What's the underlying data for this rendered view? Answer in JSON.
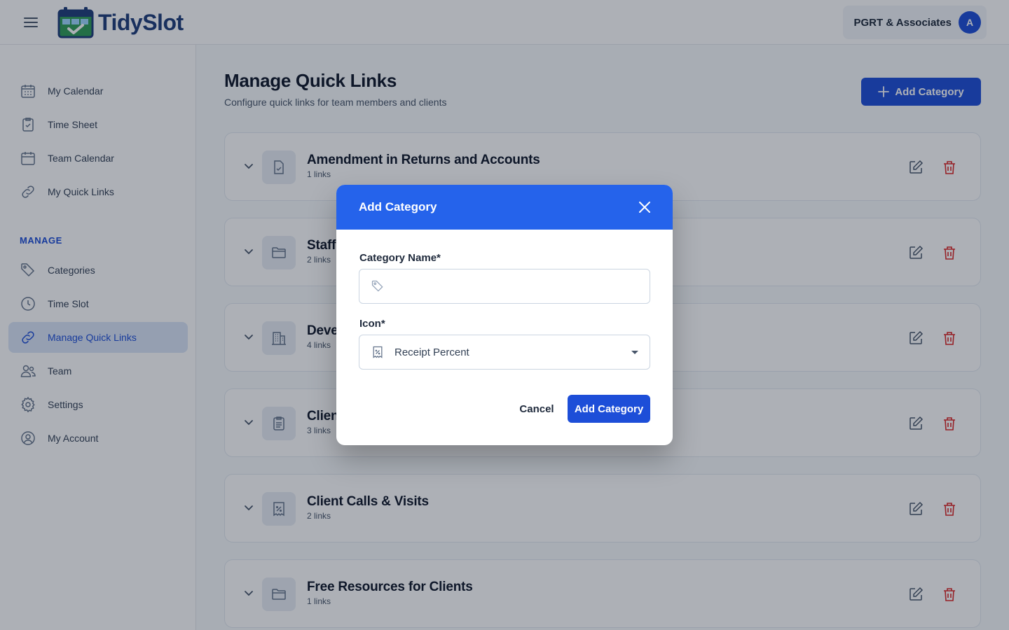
{
  "app": {
    "name": "TidySlot",
    "org_name": "PGRT & Associates",
    "avatar_initial": "A"
  },
  "sidebar": {
    "items": [
      {
        "label": "My Calendar",
        "icon": "calendar-grid-icon"
      },
      {
        "label": "Time Sheet",
        "icon": "clipboard-check-icon"
      },
      {
        "label": "Team Calendar",
        "icon": "calendar-icon"
      },
      {
        "label": "My Quick Links",
        "icon": "link-icon"
      }
    ],
    "section_label": "MANAGE",
    "manage_items": [
      {
        "label": "Categories",
        "icon": "tag-icon"
      },
      {
        "label": "Time Slot",
        "icon": "clock-icon"
      },
      {
        "label": "Manage Quick Links",
        "icon": "link-icon",
        "active": true
      },
      {
        "label": "Team",
        "icon": "users-icon"
      },
      {
        "label": "Settings",
        "icon": "gear-icon"
      },
      {
        "label": "My Account",
        "icon": "user-circle-icon"
      }
    ]
  },
  "main": {
    "title": "Manage Quick Links",
    "subtitle": "Configure quick links for team members and clients",
    "add_button_label": "Add Category",
    "categories": [
      {
        "title": "Amendment in Returns and Accounts",
        "count": "1 links",
        "icon": "document-check-icon"
      },
      {
        "title": "Staff",
        "count": "2 links",
        "icon": "folder-icon"
      },
      {
        "title": "Deve",
        "count": "4 links",
        "icon": "building-icon"
      },
      {
        "title": "Clien",
        "count": "3 links",
        "icon": "clipboard-list-icon"
      },
      {
        "title": "Client Calls & Visits",
        "count": "2 links",
        "icon": "receipt-percent-icon"
      },
      {
        "title": "Free Resources for Clients",
        "count": "1 links",
        "icon": "folder-icon"
      }
    ]
  },
  "modal": {
    "title": "Add Category",
    "name_label": "Category Name*",
    "name_value": "",
    "icon_label": "Icon*",
    "icon_value": "Receipt Percent",
    "cancel_label": "Cancel",
    "submit_label": "Add Category"
  },
  "colors": {
    "primary": "#1d4ed8",
    "modal_header": "#2563eb",
    "danger": "#dc2626"
  }
}
